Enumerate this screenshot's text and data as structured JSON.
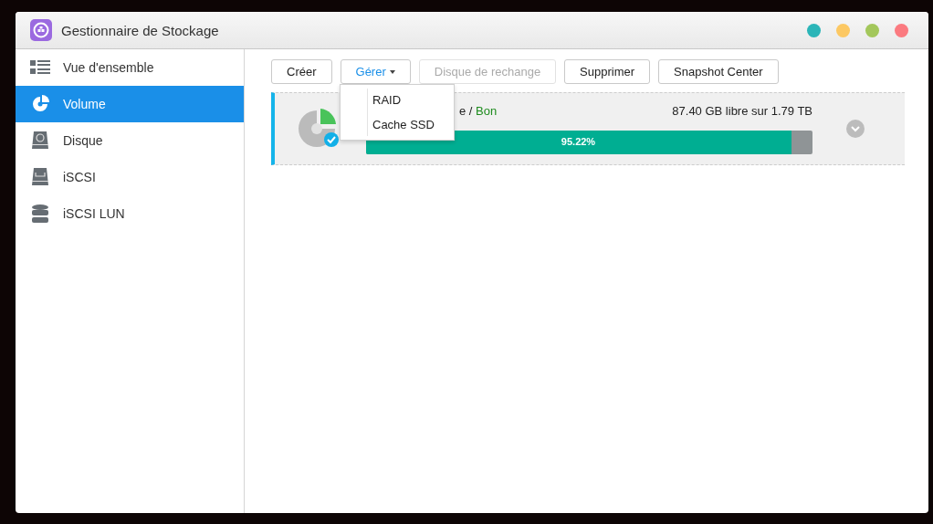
{
  "window": {
    "title": "Gestionnaire de Stockage",
    "controls": [
      {
        "color": "#2bb5b8"
      },
      {
        "color": "#fcc863"
      },
      {
        "color": "#a3c75b"
      },
      {
        "color": "#fb7a80"
      }
    ]
  },
  "sidebar": {
    "items": [
      {
        "label": "Vue d'ensemble",
        "kind": "overview",
        "selected": false
      },
      {
        "label": "Volume",
        "kind": "volume",
        "selected": true
      },
      {
        "label": "Disque",
        "kind": "disk",
        "selected": false
      },
      {
        "label": "iSCSI",
        "kind": "iscsi",
        "selected": false
      },
      {
        "label": "iSCSI LUN",
        "kind": "lun",
        "selected": false
      }
    ]
  },
  "toolbar": [
    {
      "label": "Créer",
      "disabled": false,
      "dropdown": false
    },
    {
      "label": "Gérer",
      "disabled": false,
      "dropdown": true
    },
    {
      "label": "Disque de rechange",
      "disabled": true,
      "dropdown": false
    },
    {
      "label": "Supprimer",
      "disabled": false,
      "dropdown": false
    },
    {
      "label": "Snapshot Center",
      "disabled": false,
      "dropdown": false
    }
  ],
  "menu": {
    "items": [
      "RAID",
      "Cache SSD"
    ]
  },
  "volume": {
    "name": "e /",
    "status": "Bon",
    "free": "87.40 GB libre sur 1.79 TB",
    "level": 0.9522,
    "reading": "95.22%"
  }
}
